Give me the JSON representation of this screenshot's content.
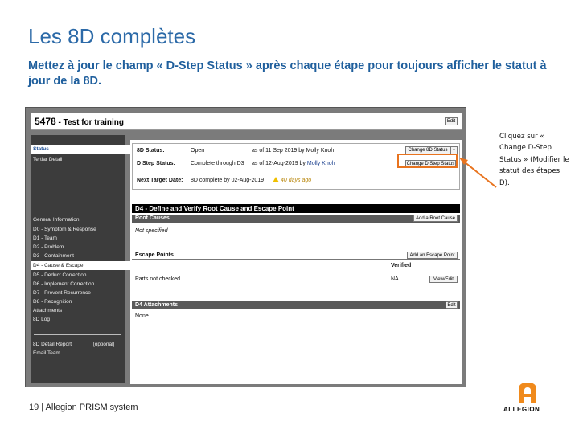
{
  "slide": {
    "title": "Les 8D complètes",
    "subtitle": "Mettez à jour le champ « D-Step Status » après chaque étape pour toujours afficher le statut à jour de la 8D.",
    "callout": "Cliquez sur « Change D-Step Status » (Modifier le statut des étapes D).",
    "footer": "19 | Allegion PRISM system",
    "logo_text": "ALLEGION"
  },
  "app": {
    "id": "5478",
    "name": " - Test for training",
    "edit_label": "Edit",
    "sidebar": {
      "top_items": [
        "Status",
        "Tertiar Detail"
      ],
      "nav_items": [
        "General Information",
        "D0 - Symptom & Response",
        "D1 - Team",
        "D2 - Problem",
        "D3 - Containment",
        "D4 - Cause & Escape",
        "D5 - Deduct Correction",
        "D6 - Implement Correction",
        "D7 - Prevent Recurrence",
        "D8 - Recognition",
        "Attachments",
        "8D Log"
      ],
      "bottom_items": [
        "8D Detail Report",
        "[optional]",
        "Email Team"
      ]
    },
    "status": {
      "status_label": "8D Status:",
      "status_value": "Open",
      "status_date": "as of 11 Sep 2019 by Molly Knoh",
      "change_status_btn": "Change 8D Status",
      "dstep_label": "D Step Status:",
      "dstep_value": "Complete through D3",
      "dstep_date": "as of 12-Aug-2019 by",
      "dstep_user": "Molly Knoh",
      "change_dstep_btn": "Change D Step Status",
      "target_label": "Next Target Date:",
      "target_value": "8D complete by 02-Aug-2019",
      "target_warning": "40 days ago"
    },
    "d4": {
      "header": "D4 - Define and Verify Root Cause and Escape Point",
      "root_causes_label": "Root Causes",
      "add_root_cause_btn": "Add a Root Cause",
      "root_causes_value": "Not specified",
      "escape_points_label": "Escape Points",
      "add_escape_point_btn": "Add an Escape Point",
      "verified_label": "Verified",
      "escape_value": "Parts not checked",
      "escape_verified": "NA",
      "view_edit_btn": "View/Edit",
      "attachments_label": "D4 Attachments",
      "attachments_edit_btn": "Edit",
      "attachments_value": "None"
    }
  },
  "colors": {
    "title": "#2c6aa8",
    "subtitle": "#1f5f9d",
    "highlight": "#e8731e",
    "logo": "#f08a1c"
  }
}
